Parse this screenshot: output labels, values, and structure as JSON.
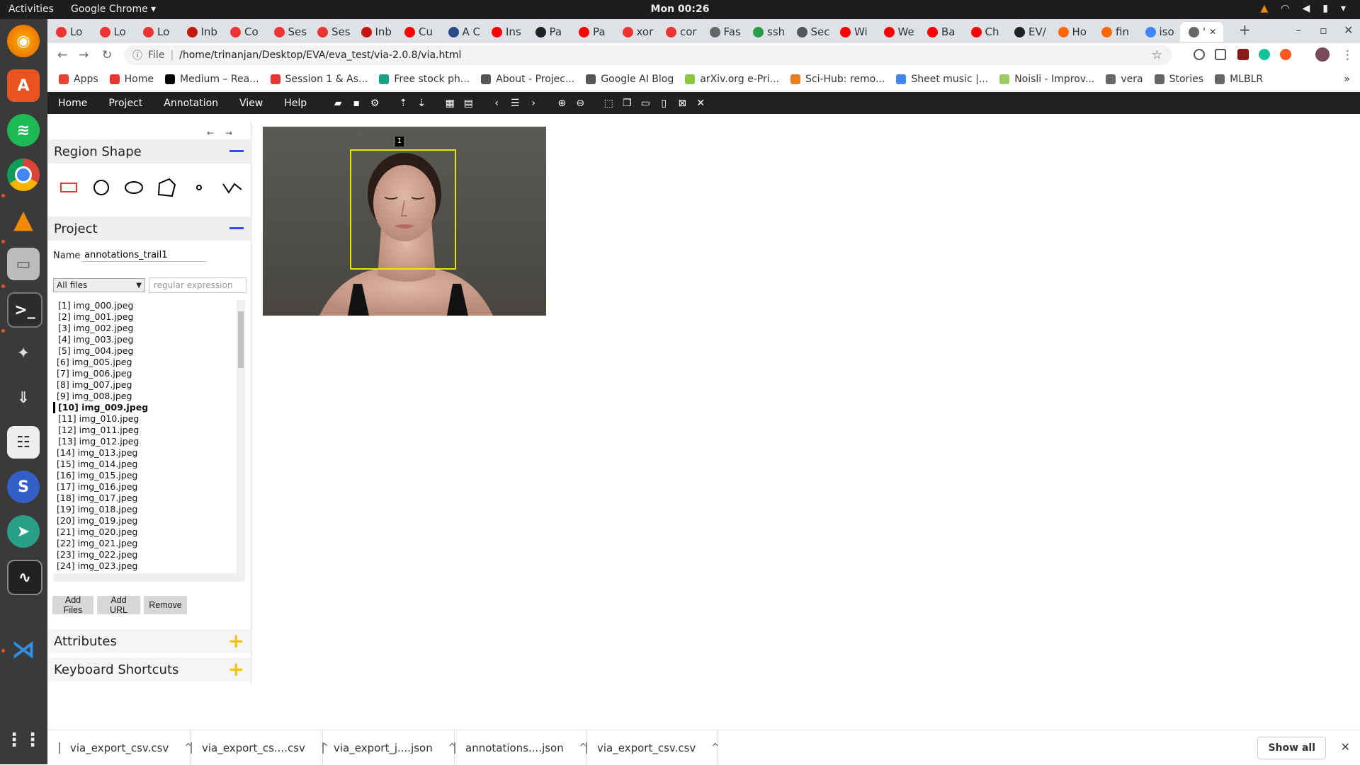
{
  "topbar": {
    "activities": "Activities",
    "app": "Google Chrome ▾",
    "clock": "Mon 00:26"
  },
  "tabs": [
    "Lo",
    "Lo",
    "Lo",
    "Inb",
    "Co",
    "Ses",
    "Ses",
    "Inb",
    "Cu",
    "A C",
    "Ins",
    "Pa",
    "Pa",
    "xor",
    "cor",
    "Fas",
    "ssh",
    "Sec",
    "Wi",
    "We",
    "Ba",
    "Ch",
    "EV/",
    "Ho",
    "fin",
    "iso",
    "'"
  ],
  "address": {
    "scheme": "File",
    "url": "/home/trinanjan/Desktop/EVA/eva_test/via-2.0.8/via.html"
  },
  "bookmarks": [
    "Apps",
    "Home",
    "Medium – Rea...",
    "Session 1 & As...",
    "Free stock ph...",
    "About - Projec...",
    "Google AI Blog",
    "arXiv.org e-Pri...",
    "Sci-Hub: remo...",
    "Sheet music |...",
    "Noisli - Improv...",
    "vera",
    "Stories",
    "MLBLR"
  ],
  "menubar": {
    "items": [
      "Home",
      "Project",
      "Annotation",
      "View",
      "Help"
    ]
  },
  "panel": {
    "nav": "← → ◂",
    "region_shape_title": "Region Shape",
    "project_title": "Project",
    "name_label": "Name:",
    "project_name": "annotations_trail1",
    "filter_selected": "All files",
    "regex_placeholder": "regular expression",
    "files": [
      "[1] img_000.jpeg",
      "[2] img_001.jpeg",
      "[3] img_002.jpeg",
      "[4] img_003.jpeg",
      "[5] img_004.jpeg",
      "[6] img_005.jpeg",
      "[7] img_006.jpeg",
      "[8] img_007.jpeg",
      "[9] img_008.jpeg",
      "[10] img_009.jpeg",
      "[11] img_010.jpeg",
      "[12] img_011.jpeg",
      "[13] img_012.jpeg",
      "[14] img_013.jpeg",
      "[15] img_014.jpeg",
      "[16] img_015.jpeg",
      "[17] img_016.jpeg",
      "[18] img_017.jpeg",
      "[19] img_018.jpeg",
      "[20] img_019.jpeg",
      "[21] img_020.jpeg",
      "[22] img_021.jpeg",
      "[23] img_022.jpeg",
      "[24] img_023.jpeg"
    ],
    "add_files": "Add Files",
    "add_url": "Add URL",
    "remove": "Remove",
    "attributes_title": "Attributes",
    "shortcuts_title": "Keyboard Shortcuts"
  },
  "canvas": {
    "region_label": "1",
    "region_color": "#e5e500"
  },
  "downloads": [
    "via_export_csv.csv",
    "via_export_cs....csv",
    "via_export_j....json",
    "annotations....json",
    "via_export_csv.csv"
  ],
  "show_all": "Show all",
  "colors": {
    "menubar": "#212121",
    "accent_minus": "#2d4ef5",
    "accent_plus": "#f1c40f",
    "dock": "#3a3a3a"
  }
}
